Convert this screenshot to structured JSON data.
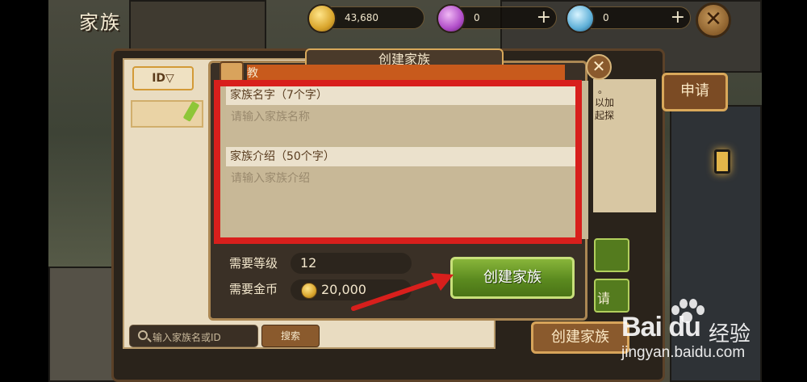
{
  "header": {
    "title": "家族"
  },
  "currencies": [
    {
      "icon": "coin-icon",
      "value": "43,680",
      "has_plus": false
    },
    {
      "icon": "gem-icon",
      "value": "0",
      "plus": "+"
    },
    {
      "icon": "diamond-icon",
      "value": "0",
      "plus": "+"
    }
  ],
  "top_close": "✕",
  "left_panel": {
    "sort_label": "ID▽",
    "search_placeholder": "输入家族名或ID",
    "search_button": "搜索"
  },
  "right_panel": {
    "apply_button": "申请",
    "info_lines": [
      "。",
      "以加",
      "起探"
    ],
    "side_button_label": "请",
    "create_button": "创建家族"
  },
  "dialog": {
    "tab_title": "创建家族",
    "strip_prefix": "教",
    "close": "✕",
    "name_field": {
      "title": "家族名字（7个字）",
      "placeholder": "请输入家族名称"
    },
    "intro_field": {
      "title": "家族介绍（50个字）",
      "placeholder": "请输入家族介绍"
    },
    "requirements": {
      "level_label": "需要等级",
      "level_value": "12",
      "gold_label": "需要金币",
      "gold_value": "20,000"
    },
    "create_button": "创建家族"
  },
  "annotation": {
    "highlight_color": "#d81f1c",
    "arrow_color": "#d81f1c"
  },
  "watermark": {
    "brand": "Bai du",
    "brand_cn": "经验",
    "url": "jingyan.baidu.com"
  }
}
